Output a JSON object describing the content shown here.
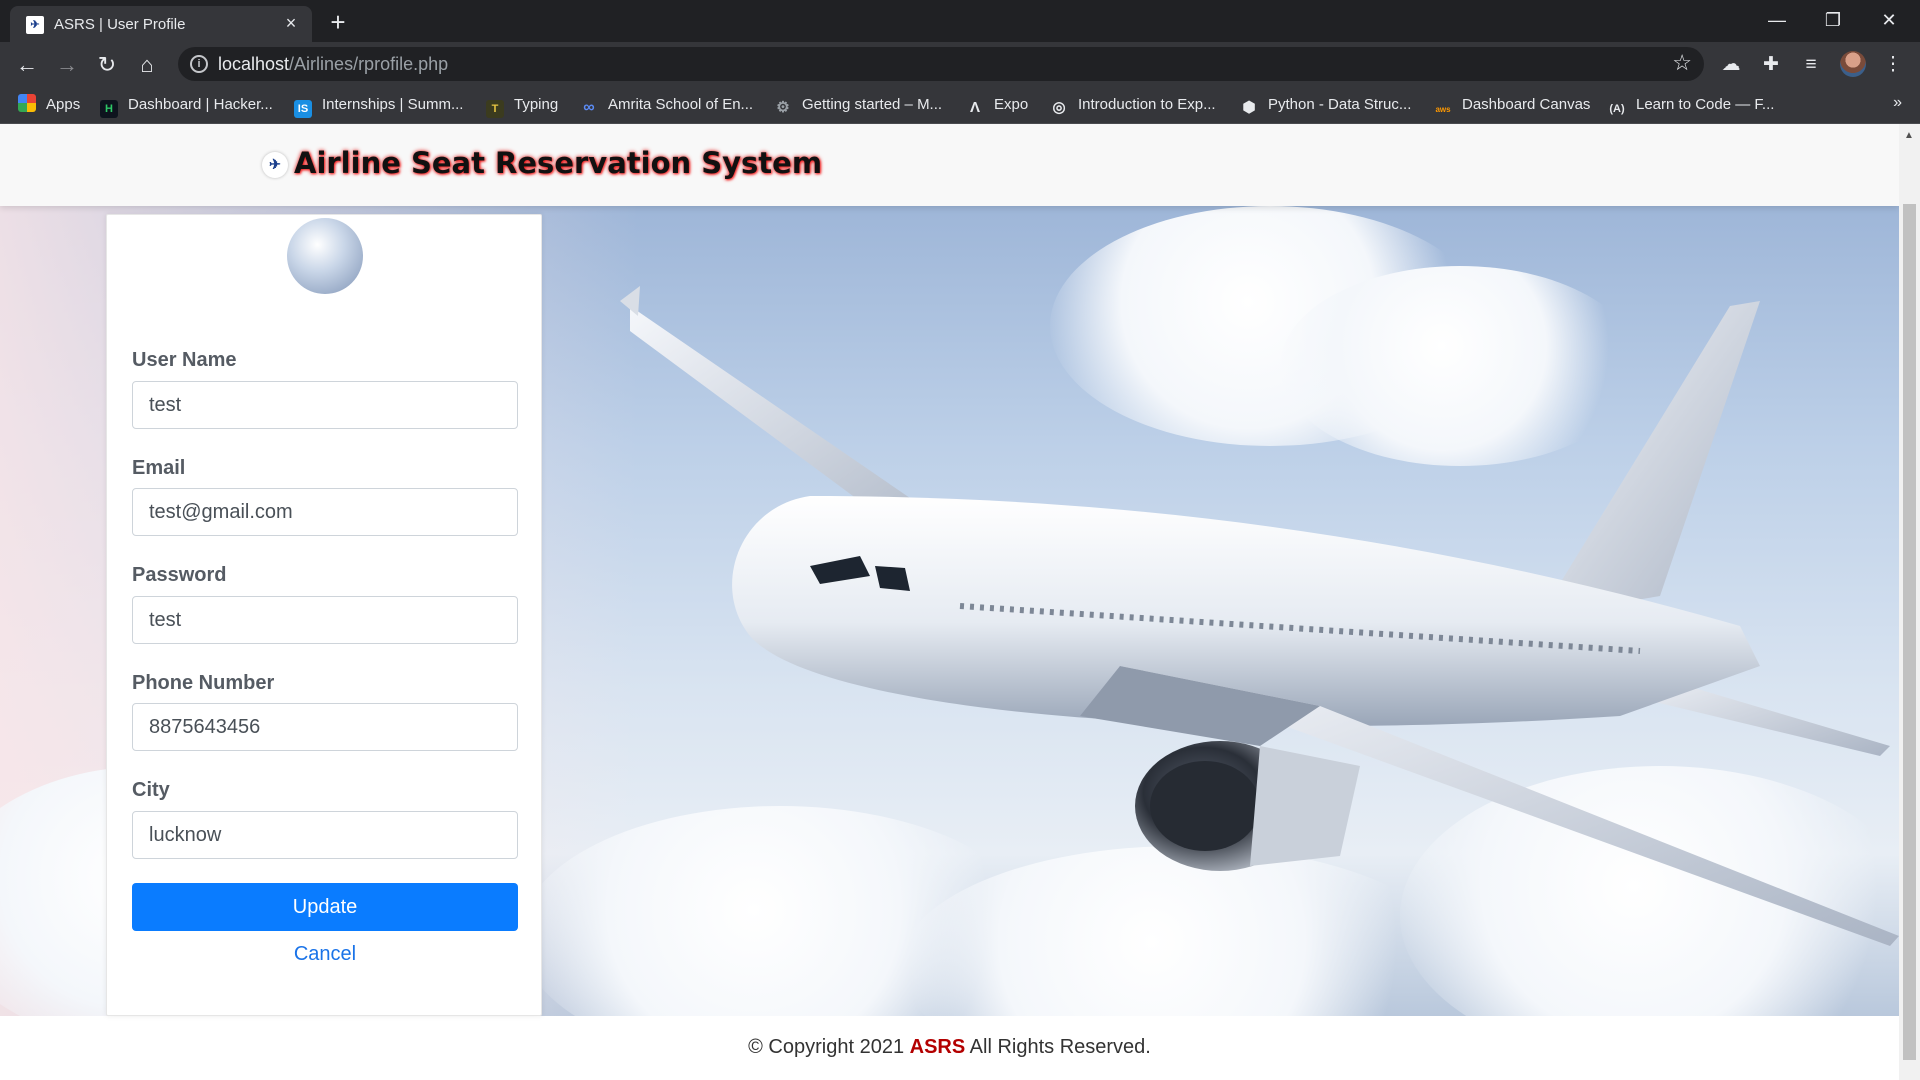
{
  "browser": {
    "tab_title": "ASRS | User Profile",
    "url_host": "localhost",
    "url_path": "/Airlines/rprofile.php",
    "bookmarks": [
      {
        "label": "Apps",
        "icon": "apps-grid-icon"
      },
      {
        "label": "Dashboard | Hacker...",
        "icon": "hackerrank-icon"
      },
      {
        "label": "Internships | Summ...",
        "icon": "internshala-icon"
      },
      {
        "label": "Typing",
        "icon": "typing-icon"
      },
      {
        "label": "Amrita School of En...",
        "icon": "infinity-icon"
      },
      {
        "label": "Getting started – M...",
        "icon": "gear-icon"
      },
      {
        "label": "Expo",
        "icon": "expo-icon"
      },
      {
        "label": "Introduction to Exp...",
        "icon": "globe-icon"
      },
      {
        "label": "Python - Data Struc...",
        "icon": "python-icon"
      },
      {
        "label": "Dashboard Canvas",
        "icon": "aws-icon"
      },
      {
        "label": "Learn to Code — F...",
        "icon": "freecodecamp-icon"
      }
    ],
    "more_bookmarks": "»"
  },
  "site": {
    "title": "Airline Seat Reservation System",
    "title_color": "#111111",
    "glow_color": "#e01010"
  },
  "form": {
    "fields": [
      {
        "label": "User Name",
        "value": "test"
      },
      {
        "label": "Email",
        "value": "test@gmail.com"
      },
      {
        "label": "Password",
        "value": "test"
      },
      {
        "label": "Phone Number",
        "value": "8875643456"
      },
      {
        "label": "City",
        "value": "lucknow"
      }
    ],
    "update_label": "Update",
    "cancel_label": "Cancel",
    "button_color": "#0a7cff"
  },
  "footer": {
    "prefix": "© Copyright 2021",
    "brand": "ASRS",
    "suffix": "All Rights Reserved."
  }
}
